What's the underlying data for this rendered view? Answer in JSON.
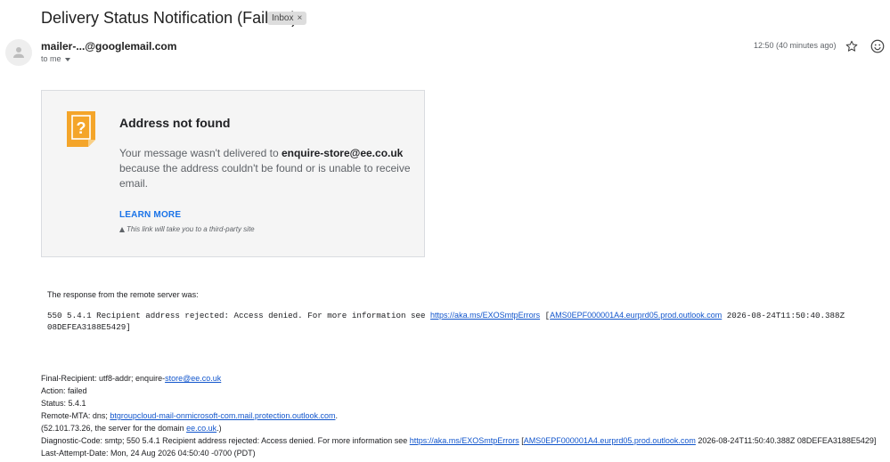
{
  "email": {
    "subject": "Delivery Status Notification (Failure)",
    "label_chip": "Inbox",
    "label_chip_close": "×",
    "sender": "mailer-...@googlemail.com",
    "recipient_label": "to me",
    "timestamp": "12:50 (40 minutes ago)"
  },
  "card": {
    "title": "Address not found",
    "body_prefix": "Your message wasn't delivered to ",
    "recipient": "enquire-store@ee.co.uk",
    "body_suffix": "because the address couldn't be found or is unable to receive email.",
    "learn_more": "LEARN MORE",
    "third_party_note": "This link will take you to a third-party site",
    "icon_glyph": "?"
  },
  "response": {
    "label": "The response from the remote server was:",
    "line1_prefix": "550 5.4.1 Recipient address rejected: Access denied. For more information see ",
    "link1": "https://aka.ms/EXOSmtpErrors",
    "line1_bracket_open": " [",
    "link2": "AMS0EPF000001A4.eurprd05.prod.outlook.com",
    "line1_after": " 2026-08-24T11:50:40.388Z",
    "line2": "08DEFEA3188E5429]"
  },
  "dsn": {
    "final_recipient_prefix": "Final-Recipient: utf8-addr; enquire-",
    "final_recipient_link": "store@ee.co.uk",
    "action": "Action: failed",
    "status": "Status: 5.4.1",
    "remote_mta_prefix": "Remote-MTA: dns; ",
    "remote_mta_link": "btgroupcloud-mail-onmicrosoft-com.mail.protection.outlook.com",
    "remote_mta_suffix": ".",
    "ip_prefix": " (52.101.73.26, the server for the domain ",
    "ip_link": "ee.co.uk",
    "ip_suffix": ".)",
    "diag_prefix": "Diagnostic-Code: smtp; 550 5.4.1 Recipient address rejected: Access denied. For more information see ",
    "diag_link1": "https://aka.ms/EXOSmtpErrors",
    "diag_space": " [",
    "diag_link2": "AMS0EPF000001A4.eurprd05.prod.outlook.com",
    "diag_suffix": " 2026-08-24T11:50:40.388Z 08DEFEA3188E5429]",
    "last_attempt": "Last-Attempt-Date: Mon, 24 Aug 2026 04:50:40 -0700 (PDT)"
  }
}
